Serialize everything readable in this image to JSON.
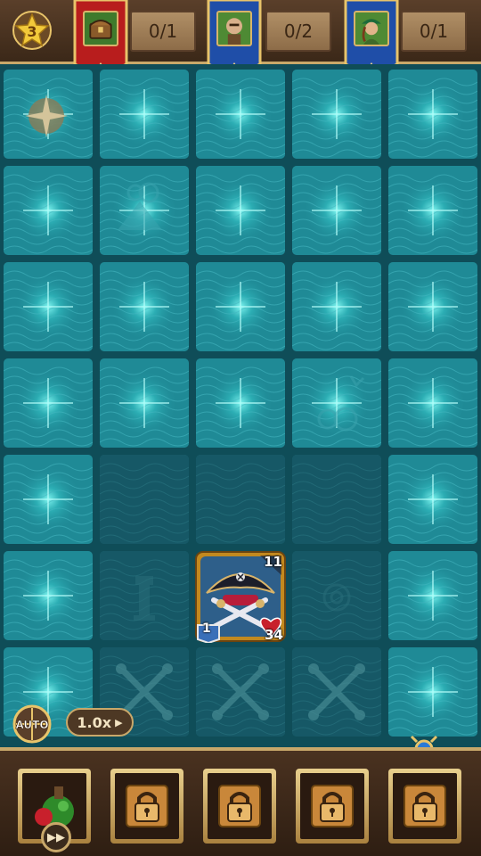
{
  "topbar": {
    "level": "3",
    "objectives": [
      {
        "icon": "treasure-chest-icon",
        "banner_color": "#b81d1d",
        "count": "0/1"
      },
      {
        "icon": "bandit-portrait-icon",
        "banner_color": "#1f4ea8",
        "count": "0/2"
      },
      {
        "icon": "pirate-woman-portrait-icon",
        "banner_color": "#1f4ea8",
        "count": "0/1"
      }
    ]
  },
  "board": {
    "rows": 7,
    "cols": 5,
    "tiles": [
      [
        "compass",
        "glow",
        "glow",
        "glow",
        "glow"
      ],
      [
        "glow",
        "mountain",
        "glow",
        "glow",
        "glow"
      ],
      [
        "glow",
        "glow",
        "glow",
        "glow",
        "glow"
      ],
      [
        "glow",
        "glow",
        "glow",
        "bird-clouds",
        "glow"
      ],
      [
        "glow",
        "dim",
        "dim",
        "dim",
        "glow"
      ],
      [
        "glow",
        "lighthouse",
        "hero",
        "spiral",
        "glow"
      ],
      [
        "glow",
        "bones",
        "bones",
        "bones",
        "glow"
      ]
    ]
  },
  "hero": {
    "icon": "pirate-captain-hat-icon",
    "attack": "11",
    "defense": "1",
    "health": "34"
  },
  "controls": {
    "auto_label": "AUTO",
    "speed_label": "1.0x"
  },
  "skills": [
    {
      "icon": "poison-bottle-icon",
      "locked": false
    },
    {
      "icon": "lock-icon",
      "locked": true
    },
    {
      "icon": "lock-icon",
      "locked": true
    },
    {
      "icon": "lock-icon",
      "locked": true
    },
    {
      "icon": "lock-icon",
      "locked": true
    }
  ],
  "colors": {
    "tile_bright": "#1f8a96",
    "tile_dim": "#165866",
    "gold": "#c9a86a",
    "heart": "#c8202c",
    "shield": "#3a6fb8"
  }
}
